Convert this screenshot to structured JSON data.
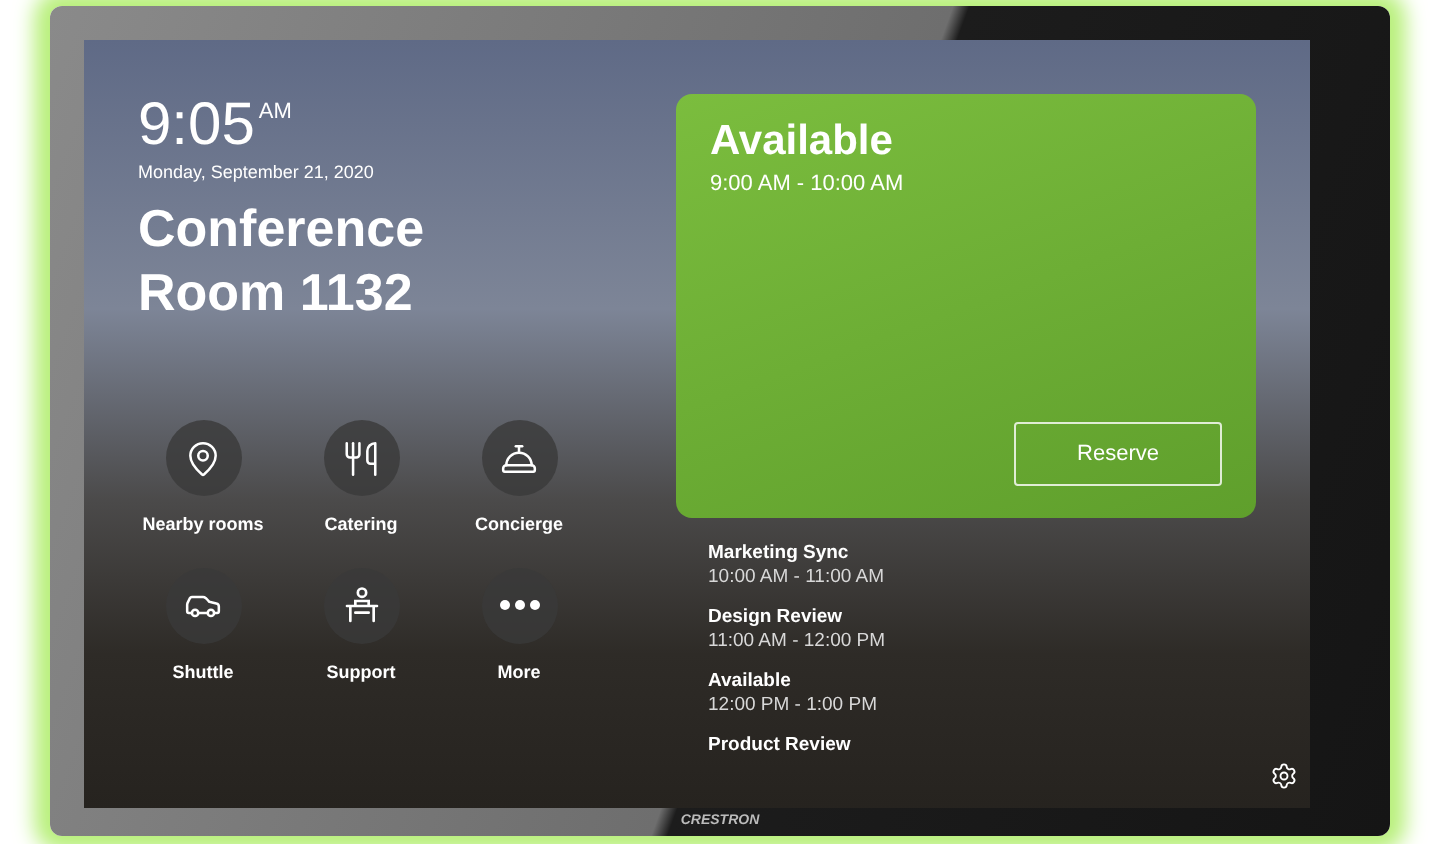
{
  "clock": {
    "time": "9:05",
    "meridiem": "AM",
    "date": "Monday, September 21, 2020"
  },
  "room": {
    "name": "Conference Room 1132"
  },
  "services": [
    {
      "label": "Nearby rooms",
      "kind": "pin"
    },
    {
      "label": "Catering",
      "kind": "cutlery"
    },
    {
      "label": "Concierge",
      "kind": "bell"
    },
    {
      "label": "Shuttle",
      "kind": "car"
    },
    {
      "label": "Support",
      "kind": "desk"
    },
    {
      "label": "More",
      "kind": "more"
    }
  ],
  "status_card": {
    "status": "Available",
    "time_range": "9:00 AM - 10:00 AM",
    "button": "Reserve"
  },
  "schedule": [
    {
      "title": "Marketing Sync",
      "time_range": "10:00 AM - 11:00 AM"
    },
    {
      "title": "Design Review",
      "time_range": "11:00 AM - 12:00 PM"
    },
    {
      "title": "Available",
      "time_range": "12:00 PM - 1:00 PM"
    },
    {
      "title": "Product Review"
    }
  ],
  "brand": "CRESTRON"
}
